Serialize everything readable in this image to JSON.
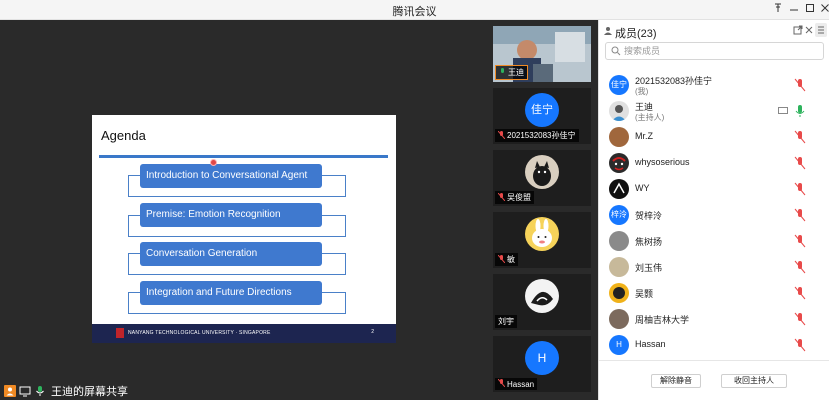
{
  "window": {
    "title": "腾讯会议"
  },
  "slide": {
    "heading": "Agenda",
    "items": [
      "Introduction to Conversational Agent",
      "Premise: Emotion Recognition",
      "Conversation Generation",
      "Integration and Future Directions"
    ],
    "footer_university": "NANYANG TECHNOLOGICAL UNIVERSITY · SINGAPORE",
    "page_number": "2",
    "colors": {
      "box": "#3f79cf",
      "footer": "#1d2550",
      "crest": "#c0242a"
    }
  },
  "share_bar": {
    "label": "王迪的屏幕共享"
  },
  "video_tiles": [
    {
      "name": "王迪",
      "type": "camera"
    },
    {
      "name": "2021532083孙佳宁",
      "avatar_text": "佳宁",
      "avatar_color": "#1677ff"
    },
    {
      "name": "吴俊盟",
      "avatar_icon": "cat-icon"
    },
    {
      "name": "敏",
      "avatar_icon": "rabbit-icon"
    },
    {
      "name": "刘宇",
      "avatar_icon": "sketch-icon"
    },
    {
      "name": "Hassan",
      "avatar_text": "H",
      "avatar_color": "#1677ff"
    }
  ],
  "panel": {
    "header": "成员(23)",
    "search_placeholder": "搜索成员",
    "members": [
      {
        "name": "2021532083孙佳宁",
        "sub": "(我)",
        "avatar_text": "佳宁",
        "avatar_color": "#1677ff",
        "mic": "muted"
      },
      {
        "name": "王迪",
        "sub": "(主持人)",
        "avatar_color": "#dcdcdc",
        "mic": "active"
      },
      {
        "name": "Mr.Z",
        "avatar_color": "#a0673c",
        "mic": "muted"
      },
      {
        "name": "whysoserious",
        "avatar_color": "#2b2b2b",
        "mic": "muted"
      },
      {
        "name": "WY",
        "avatar_color": "#101010",
        "mic": "muted"
      },
      {
        "name": "贺梓泠",
        "avatar_text": "梓泠",
        "avatar_color": "#1677ff",
        "mic": "muted"
      },
      {
        "name": "焦树扬",
        "avatar_color": "#8a8a8a",
        "mic": "muted"
      },
      {
        "name": "刘玉伟",
        "avatar_color": "#c7b99a",
        "mic": "muted"
      },
      {
        "name": "吴颢",
        "avatar_color": "#f0b21a",
        "mic": "muted"
      },
      {
        "name": "周柚吉林大学",
        "avatar_color": "#7c6a5d",
        "mic": "muted"
      },
      {
        "name": "Hassan",
        "avatar_text": "H",
        "avatar_color": "#1677ff",
        "mic": "muted"
      }
    ],
    "buttons": {
      "unmute_all": "解除静音",
      "reclaim_host": "收回主持人"
    }
  },
  "colors": {
    "accent": "#1677ff",
    "muted": "#e84a4a",
    "active": "#2db35d"
  }
}
